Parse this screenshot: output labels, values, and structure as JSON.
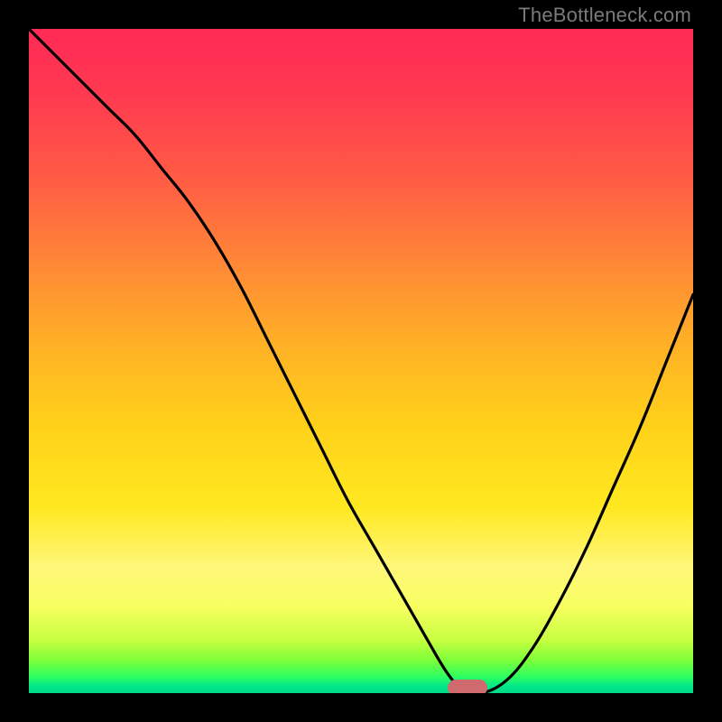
{
  "watermark": "TheBottleneck.com",
  "colors": {
    "frame": "#000000",
    "curve": "#000000",
    "marker": "#cf6a6f"
  },
  "chart_data": {
    "type": "line",
    "title": "",
    "xlabel": "",
    "ylabel": "",
    "xlim": [
      0,
      100
    ],
    "ylim": [
      0,
      100
    ],
    "note": "Values estimated from plot pixels; x is horizontal position (0 left, 100 right), y is vertical position (0 bottom, 100 top).",
    "series": [
      {
        "name": "curve",
        "x": [
          0,
          4,
          8,
          12,
          16,
          20,
          24,
          28,
          32,
          36,
          40,
          44,
          48,
          52,
          56,
          60,
          63,
          65,
          68,
          72,
          76,
          80,
          84,
          88,
          92,
          96,
          100
        ],
        "y": [
          100,
          96,
          92,
          88,
          84,
          79,
          74,
          68,
          61,
          53,
          45,
          37,
          29,
          22,
          15,
          8,
          3,
          1,
          0,
          2,
          7,
          14,
          22,
          31,
          40,
          50,
          60
        ]
      }
    ],
    "marker": {
      "x": 66,
      "y": 0.5,
      "label": ""
    },
    "flat_bottom_range_x": [
      62,
      68
    ]
  }
}
